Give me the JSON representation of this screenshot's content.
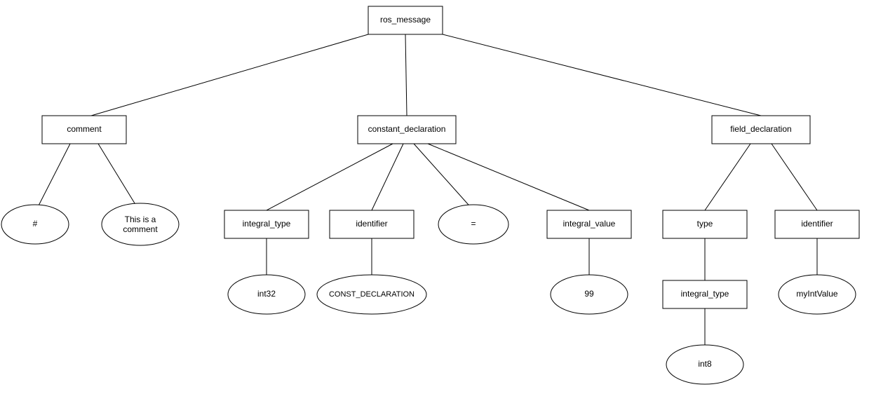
{
  "diagram": {
    "root": {
      "label": "ros_message"
    },
    "comment": {
      "label": "comment",
      "hash": "#",
      "text": "This is a comment"
    },
    "constant_declaration": {
      "label": "constant_declaration",
      "integral_type": {
        "label": "integral_type",
        "value": "int32"
      },
      "identifier": {
        "label": "identifier",
        "value": "CONST_DECLARATION"
      },
      "equals": "=",
      "integral_value": {
        "label": "integral_value",
        "value": "99"
      }
    },
    "field_declaration": {
      "label": "field_declaration",
      "type": {
        "label": "type",
        "integral_type": {
          "label": "integral_type",
          "value": "int8"
        }
      },
      "identifier": {
        "label": "identifier",
        "value": "myIntValue"
      }
    }
  }
}
